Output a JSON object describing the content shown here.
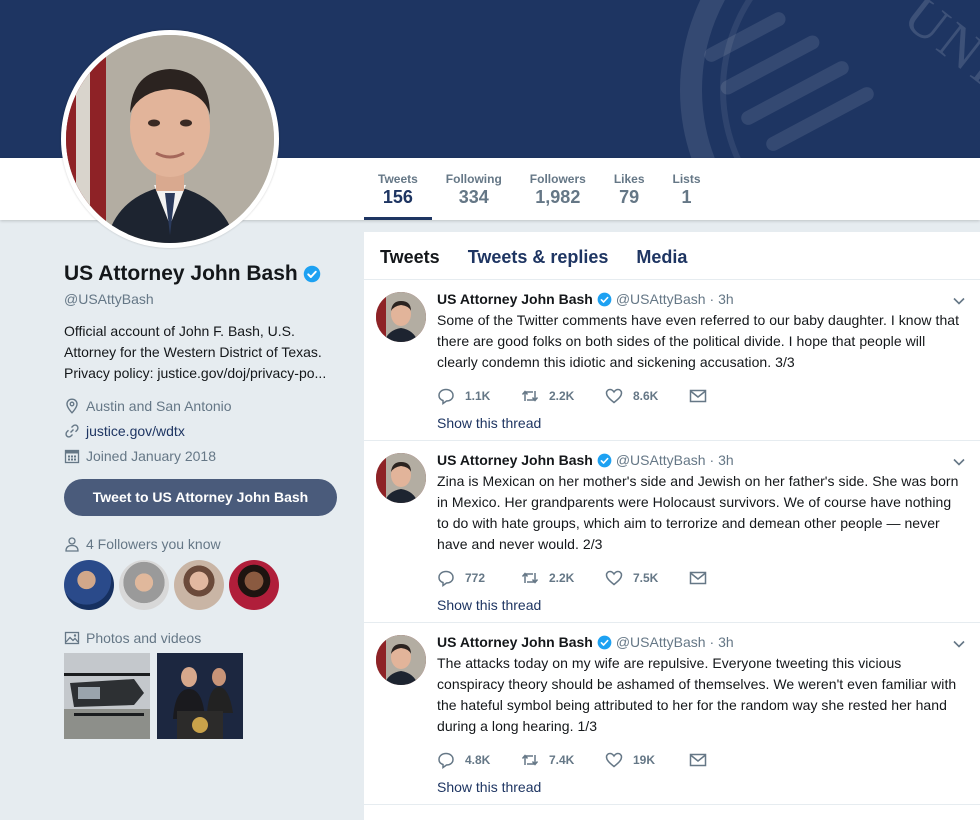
{
  "banner": {
    "text": "UNI"
  },
  "nav": {
    "stats": [
      {
        "label": "Tweets",
        "value": "156"
      },
      {
        "label": "Following",
        "value": "334"
      },
      {
        "label": "Followers",
        "value": "1,982"
      },
      {
        "label": "Likes",
        "value": "79"
      },
      {
        "label": "Lists",
        "value": "1"
      }
    ]
  },
  "profile": {
    "name": "US Attorney John Bash",
    "handle": "@USAttyBash",
    "bio": "Official account of John F. Bash, U.S. Attorney for the Western District of Texas. Privacy policy: justice.gov/doj/privacy-po...",
    "location": "Austin and San Antonio",
    "website": "justice.gov/wdtx",
    "joined": "Joined January 2018",
    "tweet_to_button": "Tweet to US Attorney John Bash",
    "followers_you_know": "4 Followers you know",
    "photos_videos": "Photos and videos"
  },
  "timeline": {
    "tabs": [
      "Tweets",
      "Tweets & replies",
      "Media"
    ],
    "tweets": [
      {
        "name": "US Attorney John Bash",
        "handle": "@USAttyBash",
        "time": "· 3h",
        "text": "Some of the Twitter comments have even referred to our baby daughter. I know that there are good folks on both sides of the political divide. I hope that people will clearly condemn this idiotic and sickening accusation. 3/3",
        "replies": "1.1K",
        "retweets": "2.2K",
        "likes": "8.6K",
        "show_thread": "Show this thread"
      },
      {
        "name": "US Attorney John Bash",
        "handle": "@USAttyBash",
        "time": "· 3h",
        "text": "Zina is Mexican on her mother's side and Jewish on her father's side. She was born in Mexico. Her grandparents were Holocaust survivors. We of course have nothing to do with hate groups, which aim to terrorize and demean other people — never have and never would. 2/3",
        "replies": "772",
        "retweets": "2.2K",
        "likes": "7.5K",
        "show_thread": "Show this thread"
      },
      {
        "name": "US Attorney John Bash",
        "handle": "@USAttyBash",
        "time": "· 3h",
        "text": "The attacks today on my wife are repulsive. Everyone tweeting this vicious conspiracy theory should be ashamed of themselves. We weren't even familiar with the hateful symbol being attributed to her for the random way she rested her hand during a long hearing. 1/3",
        "replies": "4.8K",
        "retweets": "7.4K",
        "likes": "19K",
        "show_thread": "Show this thread"
      }
    ]
  },
  "colors": {
    "brand": "#1e3562",
    "verified": "#1da1f2",
    "muted": "#657786",
    "background": "#e6ecf0"
  }
}
